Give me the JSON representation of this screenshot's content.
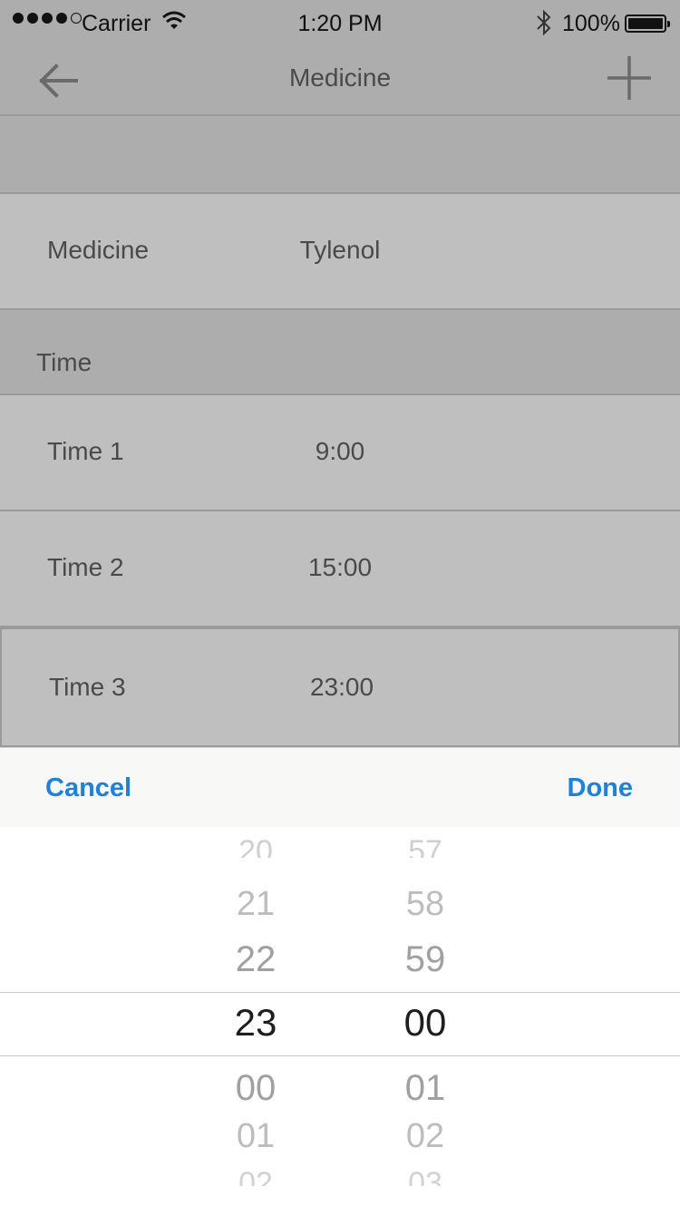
{
  "status_bar": {
    "carrier": "Carrier",
    "time": "1:20 PM",
    "battery": "100%",
    "signal_dots_filled": 4,
    "signal_dots_total": 5
  },
  "nav": {
    "title": "Medicine",
    "back_icon": "arrow-left-icon",
    "add_icon": "plus-icon"
  },
  "medicine_row": {
    "label": "Medicine",
    "value": "Tylenol"
  },
  "time_section": {
    "header": "Time"
  },
  "times": [
    {
      "label": "Time 1",
      "value": "9:00"
    },
    {
      "label": "Time 2",
      "value": "15:00"
    },
    {
      "label": "Time 3",
      "value": "23:00"
    }
  ],
  "picker_toolbar": {
    "cancel": "Cancel",
    "done": "Done"
  },
  "picker": {
    "hours": [
      "20",
      "21",
      "22",
      "23",
      "00",
      "01",
      "02"
    ],
    "minutes": [
      "57",
      "58",
      "59",
      "00",
      "01",
      "02",
      "03"
    ],
    "selected_hour": "23",
    "selected_minute": "00"
  },
  "colors": {
    "accent": "#1a82e2",
    "dim_background": "#bfbfbf",
    "dim_header": "#adadad",
    "toolbar": "#f8f8f7"
  }
}
